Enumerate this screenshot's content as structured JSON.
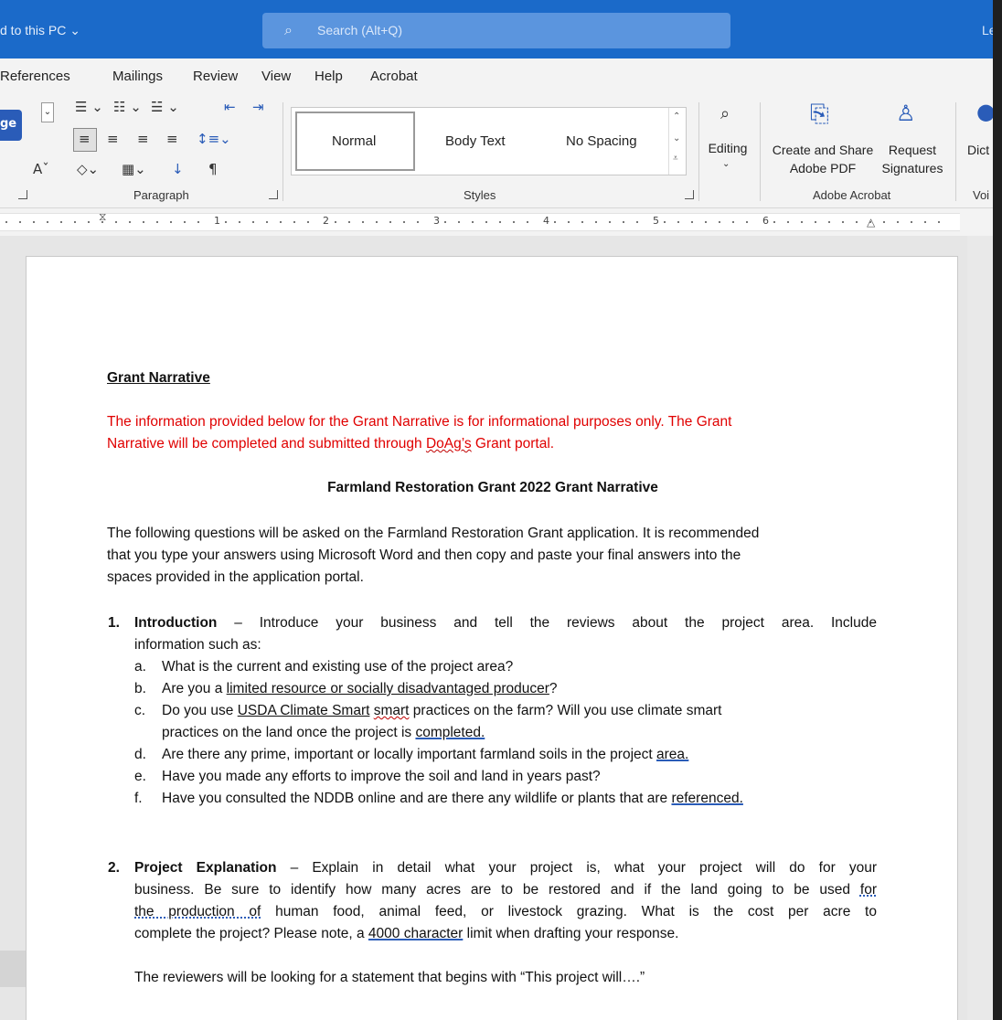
{
  "titlebar": {
    "saved": "d to this PC ⌄",
    "search_placeholder": "Search (Alt+Q)",
    "user_initials": "Le"
  },
  "menubar": [
    "References",
    "Mailings",
    "Review",
    "View",
    "Help",
    "Acrobat"
  ],
  "ribbon": {
    "paragraph_label": "Paragraph",
    "styles_label": "Styles",
    "styles": [
      "Normal",
      "Body Text",
      "No Spacing"
    ],
    "editing_label": "Editing",
    "acrobat_label": "Adobe Acrobat",
    "create_share_line1": "Create and Share",
    "create_share_line2": "Adobe PDF",
    "request_line1": "Request",
    "request_line2": "Signatures",
    "dictate_label": "Dict",
    "voice_label": "Voi",
    "left_popout": "ge",
    "font_grow": "A"
  },
  "ruler": {
    "numbers": [
      "1",
      "2",
      "3",
      "4",
      "5",
      "6"
    ]
  },
  "document": {
    "heading": "Grant Narrative",
    "notice_line1": "The information provided below for the Grant Narrative is for informational purposes only.  The Grant",
    "notice_line2_a": "Narrative will be completed and submitted through ",
    "notice_line2_b": "DoAg’s",
    "notice_line2_c": " Grant portal.",
    "center_title": "Farmland Restoration Grant 2022 Grant Narrative",
    "intro_line1": "The following questions will be asked on the Farmland Restoration Grant application. It is recommended",
    "intro_line2": "that you type your answers using Microsoft Word and then copy and paste your final answers into the",
    "intro_line3": "spaces provided in the application portal.",
    "q1_num": "1.",
    "q1_title": "Introduction",
    "q1_text_line1": " – Introduce your business and tell the reviews about the project area.  Include",
    "q1_text_line2": "information such as:",
    "q1_items": {
      "a_label": "a.",
      "a": "What is the current and existing use of the project area?",
      "b_label": "b.",
      "b_pre": "Are you a ",
      "b_link": "limited resource or socially disadvantaged producer",
      "b_post": "?",
      "c_label": "c.",
      "c_pre": "Do you use ",
      "c_link": "USDA Climate Smart",
      "c_mid": " ",
      "c_squig": "smart",
      "c_post": " practices on the farm?  Will you use climate smart",
      "c_line2_pre": "practices on the land once the project is ",
      "c_line2_u": "completed.",
      "d_label": "d.",
      "d_pre": "Are there any prime, important or locally important farmland soils in the project ",
      "d_u": "area.",
      "e_label": "e.",
      "e": "Have you made any efforts to improve the soil and land in years past?",
      "f_label": "f.",
      "f_pre": "Have you consulted the NDDB online and are there any wildlife or plants that are ",
      "f_u": "referenced."
    },
    "q2_num": "2.",
    "q2_title": "Project Explanation",
    "q2_line1": " – Explain in detail what your project is, what your project will do for your",
    "q2_line2_pre": "business.  Be sure to identify how many acres are to be restored and if the land going to be used ",
    "q2_line2_dot": "for",
    "q2_line3_dot": "the production of",
    "q2_line3_post": " human food, animal feed, or livestock grazing.  What is the cost per acre to",
    "q2_line4_pre": "complete the project?  Please note, a ",
    "q2_line4_u": "4000 character",
    "q2_line4_post": " limit when drafting your response.",
    "q2_reviewers": "The reviewers will be looking for a statement that begins with “This project will….”"
  }
}
